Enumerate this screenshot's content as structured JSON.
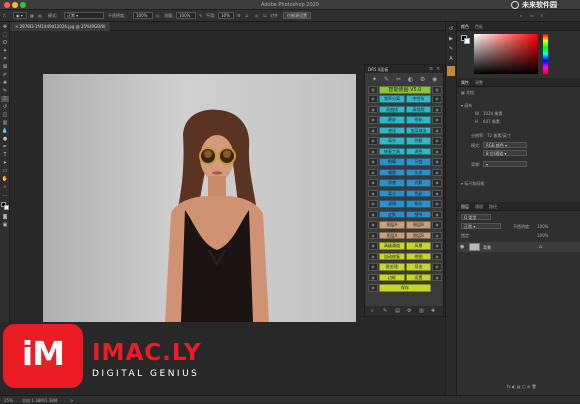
{
  "window": {
    "title": "Adobe Photoshop 2020"
  },
  "watermark": {
    "text": "未来软件园",
    "sub": "mac.orsoon.com"
  },
  "options": {
    "mode_label": "模式:",
    "mode_value": "正常",
    "opacity_label": "不透明度:",
    "opacity_value": "100%",
    "flow_label": "流量:",
    "flow_value": "100%",
    "smooth_label": "平滑:",
    "smooth_value": "10%",
    "sample_label": "对齐",
    "sample_button": "仿制源设置"
  },
  "document": {
    "tab": "2978I3-1f41449d12026.jpg @ 25%(RGB/8)",
    "close": "×"
  },
  "status": {
    "zoom": "25%",
    "info": "文档:1.38M/1.38M",
    "arrow": ">"
  },
  "plugin": {
    "title": "DR5.0面板",
    "header_label": "智能修图 V5.0",
    "close": "×",
    "menu": "≡",
    "buttons": [
      {
        "left": "频率分离",
        "right": "中性灰"
      },
      {
        "left": "双曲线",
        "right": "高低频"
      },
      {
        "left": "磨皮",
        "right": "锐化"
      },
      {
        "left": "液化",
        "right": "加深减淡"
      },
      {
        "left": "高光",
        "right": "阴影"
      },
      {
        "left": "修复工具",
        "right": "调色"
      },
      {
        "left": "眼睛",
        "right": "牙齿"
      },
      {
        "left": "嘴唇",
        "right": "头发"
      },
      {
        "left": "质感",
        "right": "光影"
      },
      {
        "left": "柔光",
        "right": "色彩"
      },
      {
        "left": "滤镜",
        "right": "锐化"
      },
      {
        "left": "皮肤",
        "right": "细节"
      },
      {
        "left": "图层A",
        "right": "图层B"
      },
      {
        "left": "图层A",
        "right": "图层B"
      },
      {
        "left": "高级通道",
        "right": "风景"
      },
      {
        "left": "自动修复",
        "right": "拼图"
      },
      {
        "left": "批处理",
        "right": "导出"
      },
      {
        "left": "边框",
        "right": "设置"
      },
      {
        "left": "保存",
        "right": ""
      }
    ],
    "bottom_icons": [
      "search-icon",
      "brush-icon",
      "folder-icon",
      "gear-icon",
      "trash-icon",
      "plus-icon"
    ]
  },
  "right_panel": {
    "tabs_top": [
      "颜色",
      "色板"
    ],
    "props_tabs": [
      "属性",
      "调整"
    ],
    "props_doc": "文档",
    "props_header": "画布",
    "width_label": "W",
    "width_value": "1024 像素",
    "height_label": "H",
    "height_value": "647 像素",
    "resolution_label": "分辨率:",
    "resolution_value": "72 像素/英寸",
    "mode_label": "模式:",
    "mode_value": "RGB 颜色",
    "bits_value": "8 位/通道",
    "fill_label": "背景:",
    "guides_header": "标尺和网格",
    "layers_tabs": [
      "图层",
      "通道",
      "路径"
    ],
    "kind_label": "Q 类型",
    "blend_mode": "正常",
    "opacity_label": "不透明度:",
    "opacity_value": "100%",
    "lock_label": "锁定:",
    "fill_value": "100%",
    "layer_name": "背景",
    "footer": "fx ◐ ▤ ▢ ⊕ 🗑"
  },
  "logo": {
    "icon_text": "iM",
    "brand": "IMAC.LY",
    "tagline": "DIGITAL GENIUS"
  },
  "colors": {
    "plugin_green": "#8fc13a",
    "plugin_teal": "#35b6c6",
    "plugin_blue": "#2f8fc6",
    "plugin_tan": "#c8a07a",
    "plugin_yellow": "#c6d62e",
    "brand_red": "#ec1c24"
  }
}
